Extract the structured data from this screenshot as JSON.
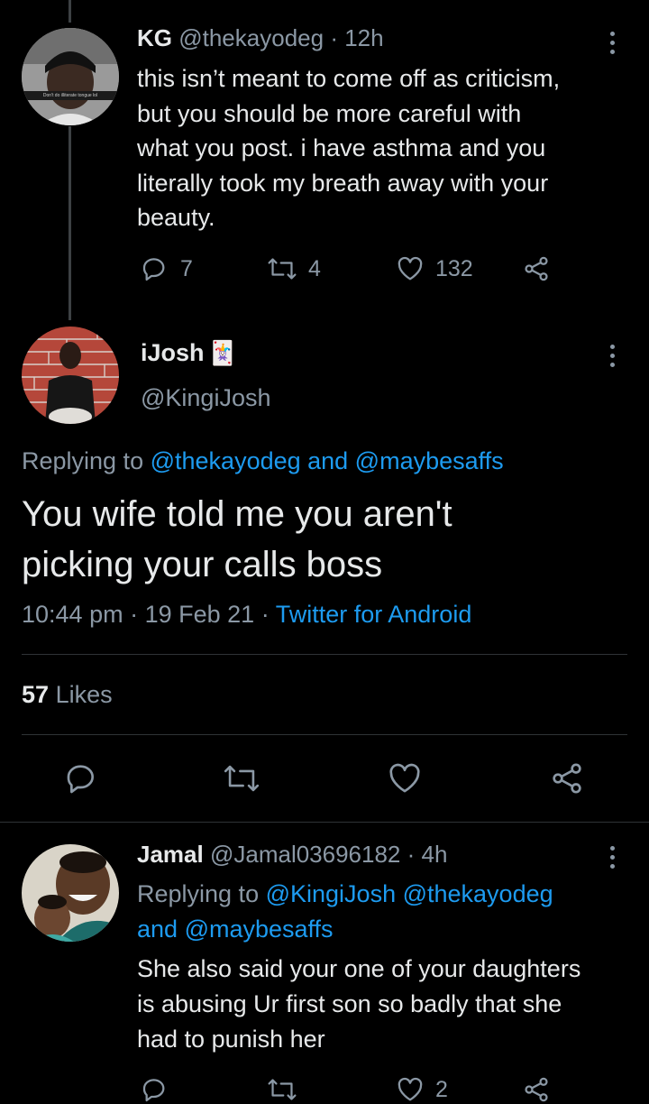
{
  "tweet1": {
    "display_name": "KG",
    "handle": "@thekayodeg",
    "time": "· 12h",
    "avatar_caption": "Don't do illiterate tongue lol",
    "text_lines": [
      "this isn’t meant to come off as criticism,",
      "but you should be more careful with",
      "what you post. i have asthma and you",
      "literally took my breath away with your",
      "beauty."
    ],
    "actions": {
      "replies": "7",
      "retweets": "4",
      "likes": "132"
    }
  },
  "main": {
    "display_name": "iJosh",
    "handle": "@KingiJosh",
    "emoji": "🃏",
    "replying_prefix": "Replying to",
    "replying_to": "@thekayodeg and @maybesaffs",
    "text_lines": [
      "You wife told me you aren't",
      "picking your calls boss"
    ],
    "time": "10:44 pm",
    "date": "19 Feb 21",
    "source": "Twitter for Android",
    "likes_count": "57",
    "likes_label": "Likes"
  },
  "reply": {
    "display_name": "Jamal",
    "handle": "@Jamal03696182",
    "time": "· 4h",
    "replying_prefix": "Replying to",
    "replying_line1": "@KingiJosh @thekayodeg",
    "replying_line2_prefix": "and",
    "replying_line2": "@maybesaffs",
    "text_lines": [
      "She also said your one of your daughters",
      "is abusing Ur first son so badly that she",
      "had to punish her"
    ],
    "actions": {
      "likes": "2"
    }
  },
  "colors": {
    "background": "#000000",
    "accent": "#1d9bf0",
    "muted": "#8b98a5",
    "divider": "#2f3336"
  },
  "icons": [
    "reply-icon",
    "retweet-icon",
    "heart-icon",
    "share-icon",
    "more-icon"
  ]
}
